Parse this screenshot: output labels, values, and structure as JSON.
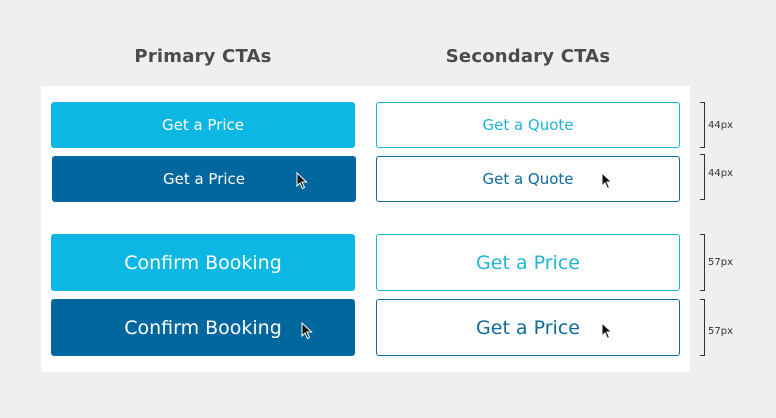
{
  "headings": {
    "primary": "Primary CTAs",
    "secondary": "Secondary CTAs"
  },
  "buttons": {
    "primary_small_default": "Get a Price",
    "primary_small_hover": "Get a Price",
    "secondary_small_default": "Get a Quote",
    "secondary_small_hover": "Get a Quote",
    "primary_large_default": "Confirm Booking",
    "primary_large_hover": "Confirm Booking",
    "secondary_large_default": "Get a Price",
    "secondary_large_hover": "Get a Price"
  },
  "dimensions": {
    "small_default": "44px",
    "small_hover": "44px",
    "large_default": "57px",
    "large_hover": "57px"
  },
  "colors": {
    "primary_default": "#0cb8e3",
    "primary_hover": "#02679e",
    "secondary_default_text": "#1fb5d8",
    "secondary_hover_text": "#0f6b9c"
  },
  "icons": {
    "cursor": "mouse-pointer-icon"
  }
}
